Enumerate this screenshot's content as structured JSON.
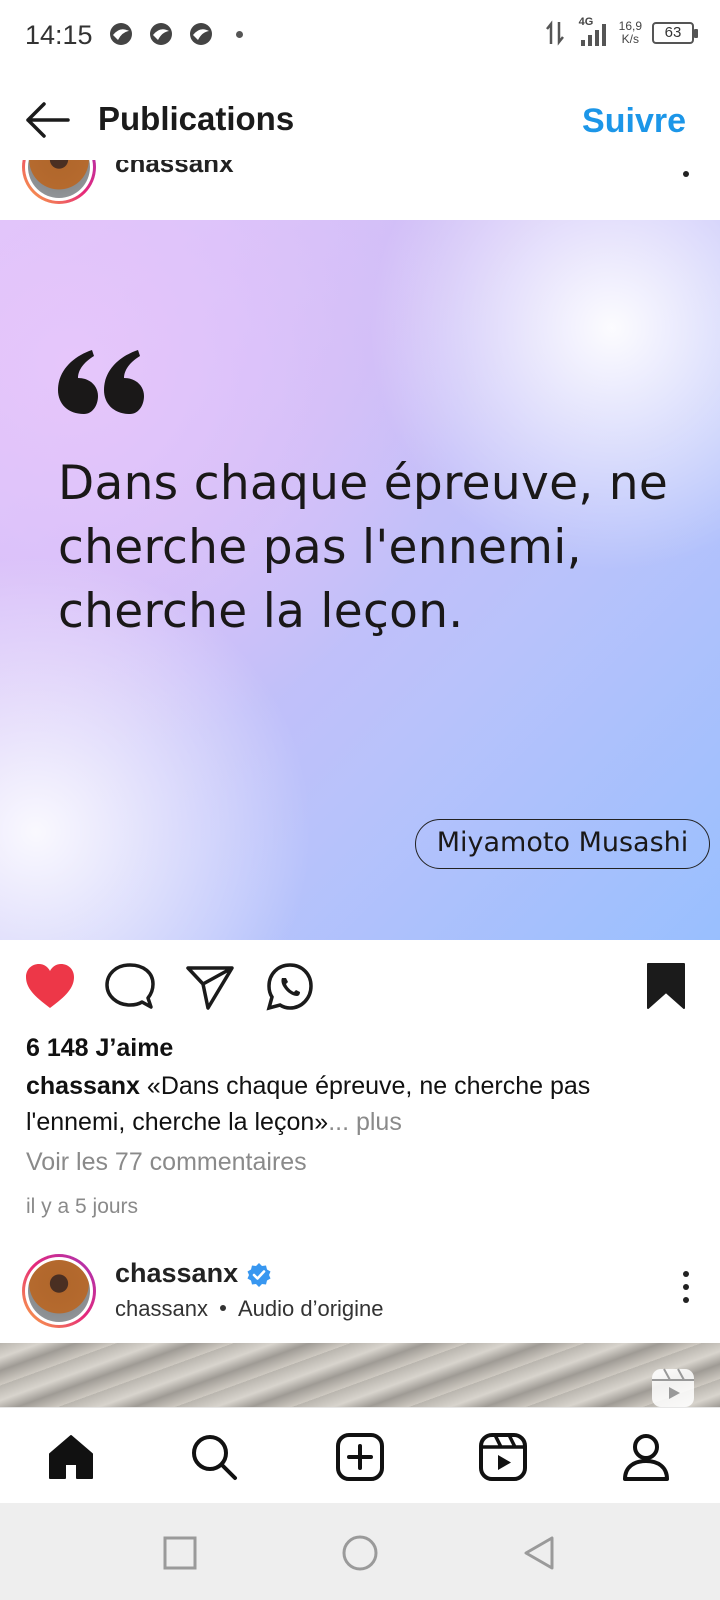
{
  "status_bar": {
    "time": "14:15",
    "network": "4G",
    "speed_value": "16,9",
    "speed_unit": "K/s",
    "battery": "63"
  },
  "header": {
    "title": "Publications",
    "follow_label": "Suivre",
    "back_icon": "arrow-left-icon"
  },
  "scrolled_post": {
    "username": "chassanx"
  },
  "post": {
    "quote": "Dans chaque épreuve, ne cherche pas l'ennemi, cherche la leçon.",
    "author": "Miyamoto Musashi",
    "liked": true,
    "saved": true,
    "likes_text": "6 148 J’aime",
    "caption_user": "chassanx",
    "caption_text": " «Dans chaque épreuve, ne cherche pas l'ennemi, cherche la leçon»",
    "caption_more": "... plus",
    "comments_link": "Voir les 77 commentaires",
    "date": "il y a 5 jours"
  },
  "next_post": {
    "username": "chassanx",
    "verified": true,
    "sub_user": "chassanx",
    "audio": "Audio d’origine"
  },
  "bottom_nav": [
    "home-icon",
    "search-icon",
    "create-icon",
    "reels-icon",
    "profile-icon"
  ],
  "system_nav": [
    "recents-button",
    "home-button",
    "back-button"
  ],
  "colors": {
    "accent": "#1c96e8",
    "like": "#ed3748",
    "verified": "#3897f0"
  }
}
